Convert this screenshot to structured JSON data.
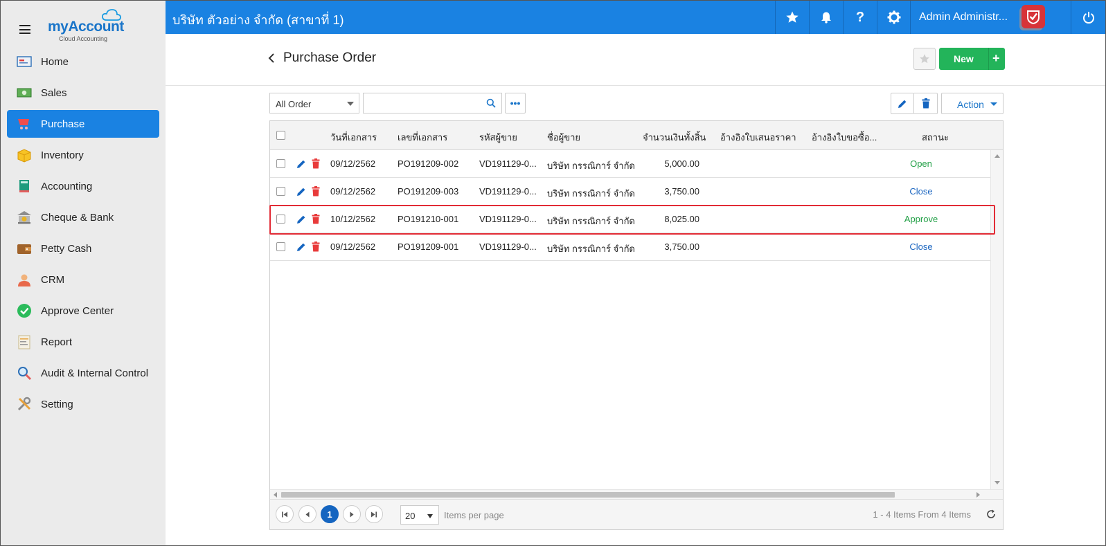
{
  "logo": {
    "brand_my": "my",
    "brand_account": "Account",
    "subtitle": "Cloud Accounting"
  },
  "sidebar": {
    "items": [
      {
        "label": "Home",
        "icon": "home-icon",
        "active": false
      },
      {
        "label": "Sales",
        "icon": "money-icon",
        "active": false
      },
      {
        "label": "Purchase",
        "icon": "cart-icon",
        "active": true
      },
      {
        "label": "Inventory",
        "icon": "box-icon",
        "active": false
      },
      {
        "label": "Accounting",
        "icon": "book-icon",
        "active": false
      },
      {
        "label": "Cheque & Bank",
        "icon": "bank-icon",
        "active": false
      },
      {
        "label": "Petty Cash",
        "icon": "wallet-icon",
        "active": false
      },
      {
        "label": "CRM",
        "icon": "people-icon",
        "active": false
      },
      {
        "label": "Approve Center",
        "icon": "check-circle-icon",
        "active": false
      },
      {
        "label": "Report",
        "icon": "report-icon",
        "active": false
      },
      {
        "label": "Audit & Internal Control",
        "icon": "magnifier-icon",
        "active": false
      },
      {
        "label": "Setting",
        "icon": "tools-icon",
        "active": false
      }
    ]
  },
  "topbar": {
    "company": "บริษัท ตัวอย่าง จำกัด (สาขาที่ 1)",
    "user_name": "Admin Administr...",
    "accent": "#1a82e2"
  },
  "page": {
    "title": "Purchase Order",
    "new_label": "New",
    "new_plus": "+"
  },
  "toolbar": {
    "filter_value": "All Order",
    "search_value": "",
    "more_label": "•••",
    "action_label": "Action"
  },
  "table": {
    "columns": [
      "วันที่เอกสาร",
      "เลขที่เอกสาร",
      "รหัสผู้ขาย",
      "ชื่อผู้ขาย",
      "จำนวนเงินทั้งสิ้น",
      "อ้างอิงใบเสนอราคา",
      "อ้างอิงใบขอซื้อ...",
      "สถานะ"
    ],
    "rows": [
      {
        "date": "09/12/2562",
        "doc_no": "PO191209-002",
        "vendor_code": "VD191129-0...",
        "vendor_name": "บริษัท กรรณิการ์ จำกัด",
        "amount": "5,000.00",
        "quote_ref": "",
        "pr_ref": "",
        "status": "Open",
        "status_color": "#23a047",
        "highlight": false
      },
      {
        "date": "09/12/2562",
        "doc_no": "PO191209-003",
        "vendor_code": "VD191129-0...",
        "vendor_name": "บริษัท กรรณิการ์ จำกัด",
        "amount": "3,750.00",
        "quote_ref": "",
        "pr_ref": "",
        "status": "Close",
        "status_color": "#1a65c0",
        "highlight": false
      },
      {
        "date": "10/12/2562",
        "doc_no": "PO191210-001",
        "vendor_code": "VD191129-0...",
        "vendor_name": "บริษัท กรรณิการ์ จำกัด",
        "amount": "8,025.00",
        "quote_ref": "",
        "pr_ref": "",
        "status": "Approve",
        "status_color": "#23a047",
        "highlight": true
      },
      {
        "date": "09/12/2562",
        "doc_no": "PO191209-001",
        "vendor_code": "VD191129-0...",
        "vendor_name": "บริษัท กรรณิการ์ จำกัด",
        "amount": "3,750.00",
        "quote_ref": "",
        "pr_ref": "",
        "status": "Close",
        "status_color": "#1a65c0",
        "highlight": false
      }
    ]
  },
  "pager": {
    "current_page": "1",
    "page_size": "20",
    "items_per_page_label": "Items per page",
    "info": "1 - 4 Items From 4 Items"
  }
}
